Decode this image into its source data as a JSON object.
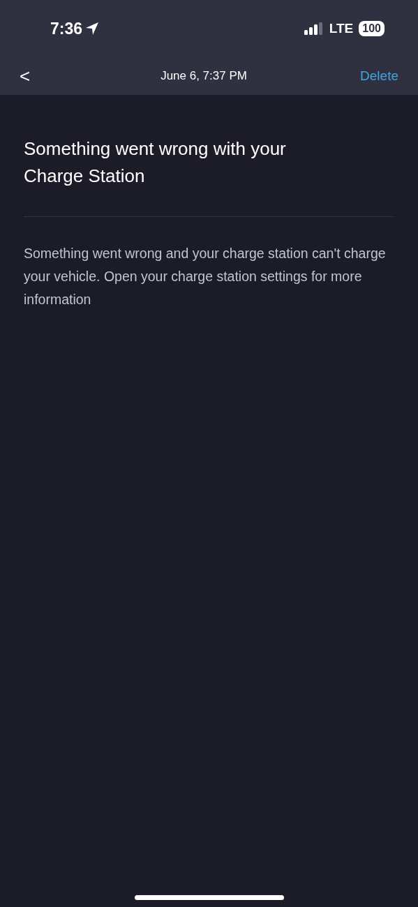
{
  "status_bar": {
    "time": "7:36",
    "network": "LTE",
    "battery": "100"
  },
  "nav_bar": {
    "back": "<",
    "title": "June 6, 7:37 PM",
    "action": "Delete"
  },
  "message": {
    "title": "Something went wrong with your Charge Station",
    "body": "Something went wrong and your charge station can't charge your vehicle. Open your charge station settings for more information"
  }
}
